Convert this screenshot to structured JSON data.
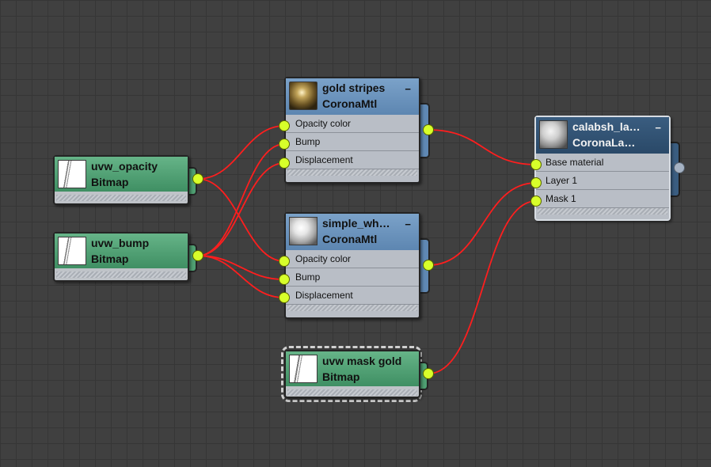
{
  "colors": {
    "canvas": "#404040",
    "grid": "#363636",
    "wire": "#ff1e1e",
    "socket": "#d8ff2a",
    "material_header": "#6a93bd",
    "layered_header": "#2f4f70",
    "bitmap_header": "#55a577"
  },
  "nodes": {
    "gold_stripes": {
      "title": "gold stripes",
      "type": "CoronaMtl",
      "slots": [
        "Opacity color",
        "Bump",
        "Displacement"
      ],
      "minimize": "−"
    },
    "simple_white": {
      "title": "simple_wh…",
      "type": "CoronaMtl",
      "slots": [
        "Opacity color",
        "Bump",
        "Displacement"
      ],
      "minimize": "−"
    },
    "calabsh": {
      "title": "calabsh_la…",
      "type": "CoronaLa…",
      "slots": [
        "Base material",
        "Layer 1",
        "Mask 1"
      ],
      "minimize": "−"
    },
    "uvw_opacity": {
      "title": "uvw_opacity",
      "type": "Bitmap"
    },
    "uvw_bump": {
      "title": "uvw_bump",
      "type": "Bitmap"
    },
    "uvw_mask_gold": {
      "title": "uvw mask gold",
      "type": "Bitmap"
    }
  }
}
